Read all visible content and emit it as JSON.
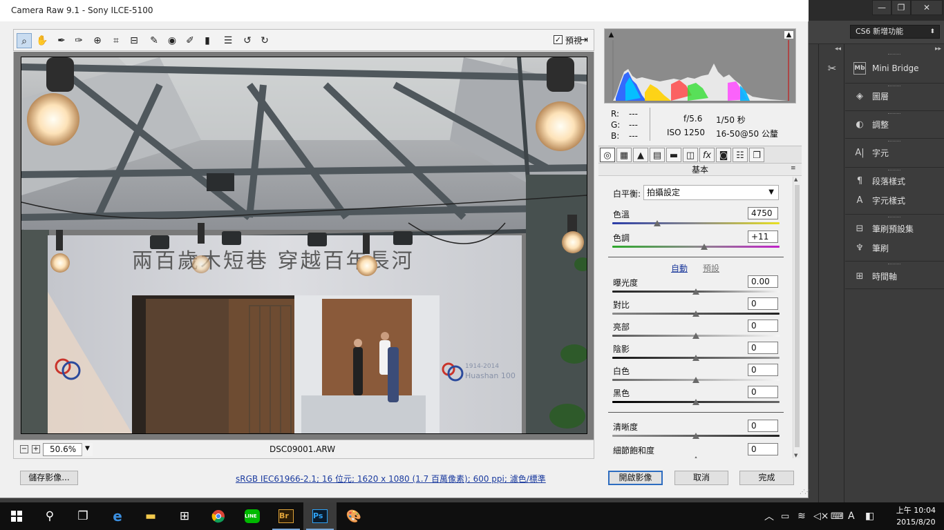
{
  "dialog": {
    "title": "Camera Raw 9.1  -  Sony ILCE-5100",
    "preview_checked": "✓",
    "preview_label": "預視",
    "zoom_value": "50.6%",
    "filename": "DSC09001.ARW",
    "info_link": "sRGB IEC61966-2.1; 16 位元; 1620 x 1080 (1.7 百萬像素); 600 ppi; 濾色/標準",
    "buttons": {
      "save_image": "儲存影像...",
      "open_image": "開啟影像",
      "cancel": "取消",
      "done": "完成"
    }
  },
  "toolbar_icons": [
    "zoom-icon",
    "hand-icon",
    "white-balance-icon",
    "color-sampler-icon",
    "targeted-adjustment-icon",
    "crop-icon",
    "straighten-icon",
    "spot-removal-icon",
    "red-eye-icon",
    "adjustment-brush-icon",
    "graduated-filter-icon",
    "preferences-icon",
    "rotate-ccw-icon",
    "rotate-cw-icon"
  ],
  "rgb": {
    "r_label": "R:",
    "g_label": "G:",
    "b_label": "B:",
    "r": "---",
    "g": "---",
    "b": "---"
  },
  "exif": {
    "aperture": "f/5.6",
    "shutter": "1/50 秒",
    "iso": "ISO 1250",
    "lens": "16-50@50 公釐"
  },
  "panel": {
    "name": "基本",
    "white_balance_label": "白平衡:",
    "white_balance_value": "拍攝設定",
    "auto_link": "自動",
    "default_link": "預設",
    "temp": {
      "label": "色溫",
      "value": "4750",
      "fraction": 0.27
    },
    "tint": {
      "label": "色調",
      "value": "+11",
      "fraction": 0.55
    },
    "exposure": {
      "label": "曝光度",
      "value": "0.00",
      "fraction": 0.5
    },
    "contrast": {
      "label": "對比",
      "value": "0",
      "fraction": 0.5
    },
    "highlights": {
      "label": "亮部",
      "value": "0",
      "fraction": 0.5
    },
    "shadows": {
      "label": "陰影",
      "value": "0",
      "fraction": 0.5
    },
    "whites": {
      "label": "白色",
      "value": "0",
      "fraction": 0.5
    },
    "blacks": {
      "label": "黑色",
      "value": "0",
      "fraction": 0.5
    },
    "clarity": {
      "label": "清晰度",
      "value": "0",
      "fraction": 0.5
    },
    "vibrance": {
      "label": "細節飽和度",
      "value": "0",
      "fraction": 0.5
    }
  },
  "photo": {
    "sign_text": "兩百歲木短巷  穿越百年長河",
    "logo_text_1": "1914-2014",
    "logo_text_2": "Huashan 100"
  },
  "photoshop": {
    "workspace": "CS6 新增功能",
    "panels": [
      "Mini Bridge",
      "圖層",
      "調整",
      "字元",
      "段落樣式",
      "字元樣式",
      "筆刷預設集",
      "筆刷",
      "時間軸"
    ],
    "window_buttons": [
      "—",
      "❐",
      "✕"
    ]
  },
  "taskbar": {
    "clock_time": "上午 10:04",
    "clock_date": "2015/8/20",
    "ime": "A",
    "br_label": "Br",
    "ps_label": "Ps"
  },
  "colors": {
    "accent": "#2d6cc0",
    "link": "#1a3a9e",
    "ps_bg": "#3c3c3c"
  }
}
